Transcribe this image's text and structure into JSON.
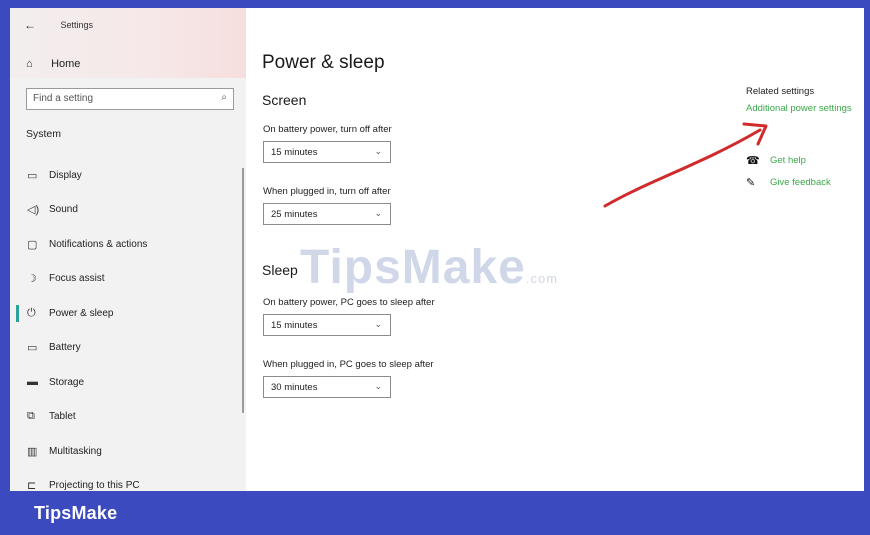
{
  "window": {
    "title": "Settings"
  },
  "sidebar": {
    "home": "Home",
    "search_placeholder": "Find a setting",
    "section": "System",
    "items": [
      {
        "label": "Display",
        "icon": "monitor-icon"
      },
      {
        "label": "Sound",
        "icon": "speaker-icon"
      },
      {
        "label": "Notifications & actions",
        "icon": "notification-icon"
      },
      {
        "label": "Focus assist",
        "icon": "moon-icon"
      },
      {
        "label": "Power & sleep",
        "icon": "power-icon",
        "active": true
      },
      {
        "label": "Battery",
        "icon": "battery-icon"
      },
      {
        "label": "Storage",
        "icon": "storage-icon"
      },
      {
        "label": "Tablet",
        "icon": "tablet-icon"
      },
      {
        "label": "Multitasking",
        "icon": "multitasking-icon"
      },
      {
        "label": "Projecting to this PC",
        "icon": "projecting-icon"
      }
    ]
  },
  "main": {
    "title": "Power & sleep",
    "screen": {
      "heading": "Screen",
      "battery_label": "On battery power, turn off after",
      "battery_value": "15 minutes",
      "plugged_label": "When plugged in, turn off after",
      "plugged_value": "25 minutes"
    },
    "sleep": {
      "heading": "Sleep",
      "battery_label": "On battery power, PC goes to sleep after",
      "battery_value": "15 minutes",
      "plugged_label": "When plugged in, PC goes to sleep after",
      "plugged_value": "30 minutes"
    },
    "related": {
      "heading": "Related settings",
      "link": "Additional power settings",
      "help": "Get help",
      "feedback": "Give feedback"
    }
  },
  "watermark": {
    "text": "TipsMake",
    "suffix": ".com"
  },
  "brand": {
    "text": "TipsMake"
  },
  "colors": {
    "accent": "#2aa19a",
    "link": "#3aa84a",
    "frame": "#3b4bbf",
    "arrow": "#d02a2a"
  }
}
